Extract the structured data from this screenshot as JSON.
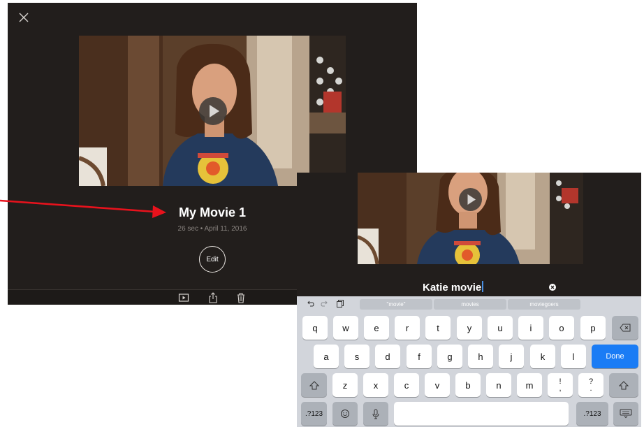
{
  "project": {
    "title": "My Movie 1",
    "meta": "26 sec • April 11, 2016",
    "edit_label": "Edit"
  },
  "rename": {
    "value": "Katie movie"
  },
  "suggestions": [
    "\"movie\"",
    "movies",
    "moviegoers"
  ],
  "keyboard": {
    "row1": [
      "q",
      "w",
      "e",
      "r",
      "t",
      "y",
      "u",
      "i",
      "o",
      "p"
    ],
    "row2": [
      "a",
      "s",
      "d",
      "f",
      "g",
      "h",
      "j",
      "k",
      "l"
    ],
    "row3": [
      "z",
      "x",
      "c",
      "v",
      "b",
      "n",
      "m"
    ],
    "punct1": [
      "!",
      ","
    ],
    "punct2": [
      "?",
      "."
    ],
    "done_label": "Done",
    "numbers_label": ".?123"
  },
  "colors": {
    "accent": "#1a7cf5",
    "arrow": "#e8121c",
    "panel_bg": "#221e1c"
  },
  "icons": [
    "close-icon",
    "play-icon",
    "share-icon",
    "trash-icon",
    "undo-icon",
    "redo-icon",
    "paste-icon",
    "clear-icon",
    "backspace-icon",
    "shift-icon",
    "emoji-icon",
    "microphone-icon",
    "keyboard-dismiss-icon"
  ]
}
